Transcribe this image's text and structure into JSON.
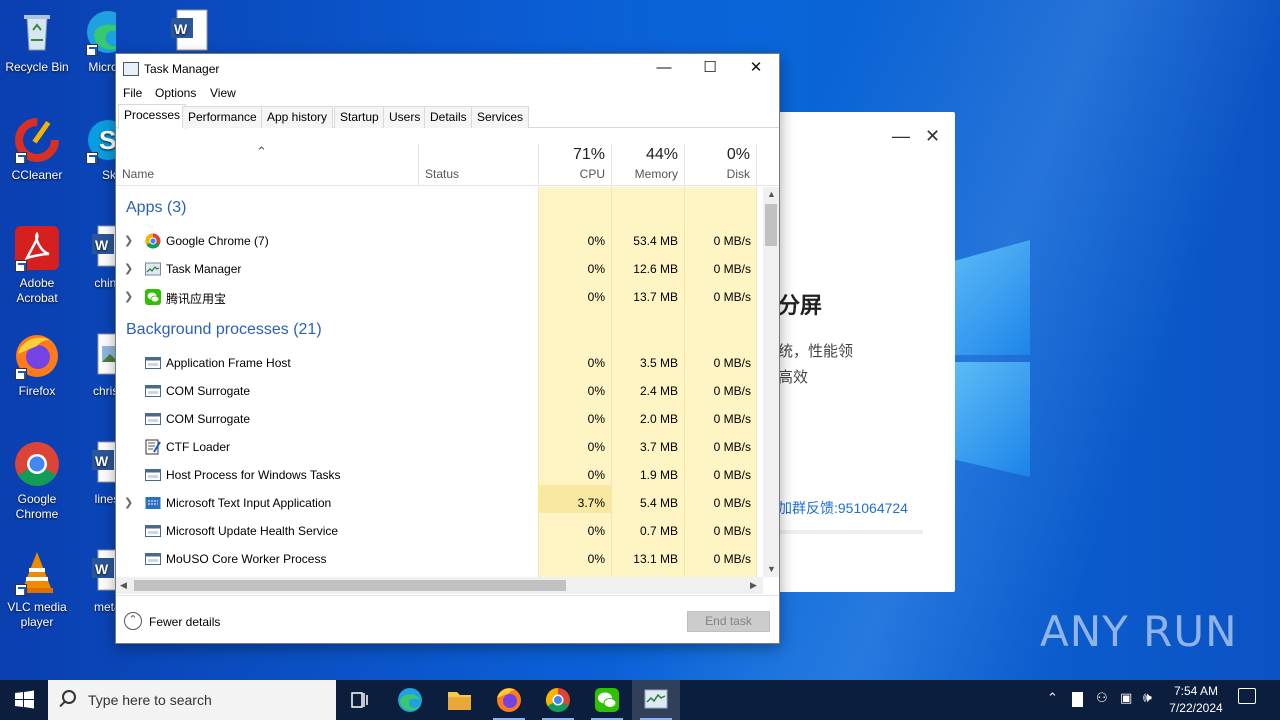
{
  "desktop": {
    "icons_left": [
      {
        "label": "Recycle Bin",
        "icon": "recycle-bin-icon"
      },
      {
        "label": "CCleaner",
        "icon": "ccleaner-icon"
      },
      {
        "label": "Adobe Acrobat",
        "icon": "acrobat-icon"
      },
      {
        "label": "Firefox",
        "icon": "firefox-icon"
      },
      {
        "label": "Google Chrome",
        "icon": "chrome-icon"
      },
      {
        "label": "VLC media player",
        "icon": "vlc-icon"
      }
    ],
    "icons_right": [
      {
        "label": "Micro Ed",
        "icon": "edge-icon"
      },
      {
        "label": "Sky",
        "icon": "skype-icon"
      },
      {
        "label": "chinap",
        "icon": "word-doc-icon"
      },
      {
        "label": "christia",
        "icon": "image-file-icon"
      },
      {
        "label": "lineste",
        "icon": "word-doc-icon"
      },
      {
        "label": "metaln",
        "icon": "word-doc-icon"
      }
    ],
    "watermark": "ANY RUN"
  },
  "bg_window": {
    "heading": "分屏",
    "line1": "统，性能领",
    "line2": "高效",
    "link": "加群反馈:951064724"
  },
  "task_manager": {
    "title": "Task Manager",
    "menu": [
      "File",
      "Options",
      "View"
    ],
    "tabs": [
      "Processes",
      "Performance",
      "App history",
      "Startup",
      "Users",
      "Details",
      "Services"
    ],
    "active_tab": "Processes",
    "columns": {
      "name": "Name",
      "status": "Status",
      "cpu": {
        "pct": "71%",
        "label": "CPU"
      },
      "memory": {
        "pct": "44%",
        "label": "Memory"
      },
      "disk": {
        "pct": "0%",
        "label": "Disk"
      }
    },
    "groups": [
      {
        "title": "Apps (3)"
      },
      {
        "title": "Background processes (21)"
      }
    ],
    "apps": [
      {
        "name": "Google Chrome (7)",
        "icon": "chrome-icon",
        "expandable": true,
        "cpu": "0%",
        "memory": "53.4 MB",
        "disk": "0 MB/s"
      },
      {
        "name": "Task Manager",
        "icon": "task-manager-icon",
        "expandable": true,
        "cpu": "0%",
        "memory": "12.6 MB",
        "disk": "0 MB/s"
      },
      {
        "name": "腾讯应用宝",
        "icon": "wechat-icon",
        "expandable": true,
        "cpu": "0%",
        "memory": "13.7 MB",
        "disk": "0 MB/s"
      }
    ],
    "background": [
      {
        "name": "Application Frame Host",
        "icon": "window-app-icon",
        "expandable": false,
        "cpu": "0%",
        "memory": "3.5 MB",
        "disk": "0 MB/s"
      },
      {
        "name": "COM Surrogate",
        "icon": "window-app-icon",
        "expandable": false,
        "cpu": "0%",
        "memory": "2.4 MB",
        "disk": "0 MB/s"
      },
      {
        "name": "COM Surrogate",
        "icon": "window-app-icon",
        "expandable": false,
        "cpu": "0%",
        "memory": "2.0 MB",
        "disk": "0 MB/s"
      },
      {
        "name": "CTF Loader",
        "icon": "ctf-loader-icon",
        "expandable": false,
        "cpu": "0%",
        "memory": "3.7 MB",
        "disk": "0 MB/s"
      },
      {
        "name": "Host Process for Windows Tasks",
        "icon": "window-app-icon",
        "expandable": false,
        "cpu": "0%",
        "memory": "1.9 MB",
        "disk": "0 MB/s"
      },
      {
        "name": "Microsoft Text Input Application",
        "icon": "text-input-icon",
        "expandable": true,
        "cpu": "3.7%",
        "memory": "5.4 MB",
        "disk": "0 MB/s"
      },
      {
        "name": "Microsoft Update Health Service",
        "icon": "window-app-icon",
        "expandable": false,
        "cpu": "0%",
        "memory": "0.7 MB",
        "disk": "0 MB/s"
      },
      {
        "name": "MoUSO Core Worker Process",
        "icon": "window-app-icon",
        "expandable": false,
        "cpu": "0%",
        "memory": "13.1 MB",
        "disk": "0 MB/s"
      }
    ],
    "footer": {
      "fewer_details": "Fewer details",
      "end_task": "End task"
    }
  },
  "taskbar": {
    "search_placeholder": "Type here to search",
    "time": "7:54 AM",
    "date": "7/22/2024",
    "pinned": [
      "task-view-icon",
      "edge-icon",
      "file-explorer-icon",
      "firefox-icon",
      "chrome-icon",
      "wechat-icon",
      "task-manager-icon"
    ]
  },
  "colors": {
    "desktop_blue": "#0b5fd6",
    "group_title": "#2b61b6",
    "cpu_heat": "#fff4c4",
    "cpu_heat_high": "#f9e8a0",
    "taskbar": "#0c1e3e"
  }
}
